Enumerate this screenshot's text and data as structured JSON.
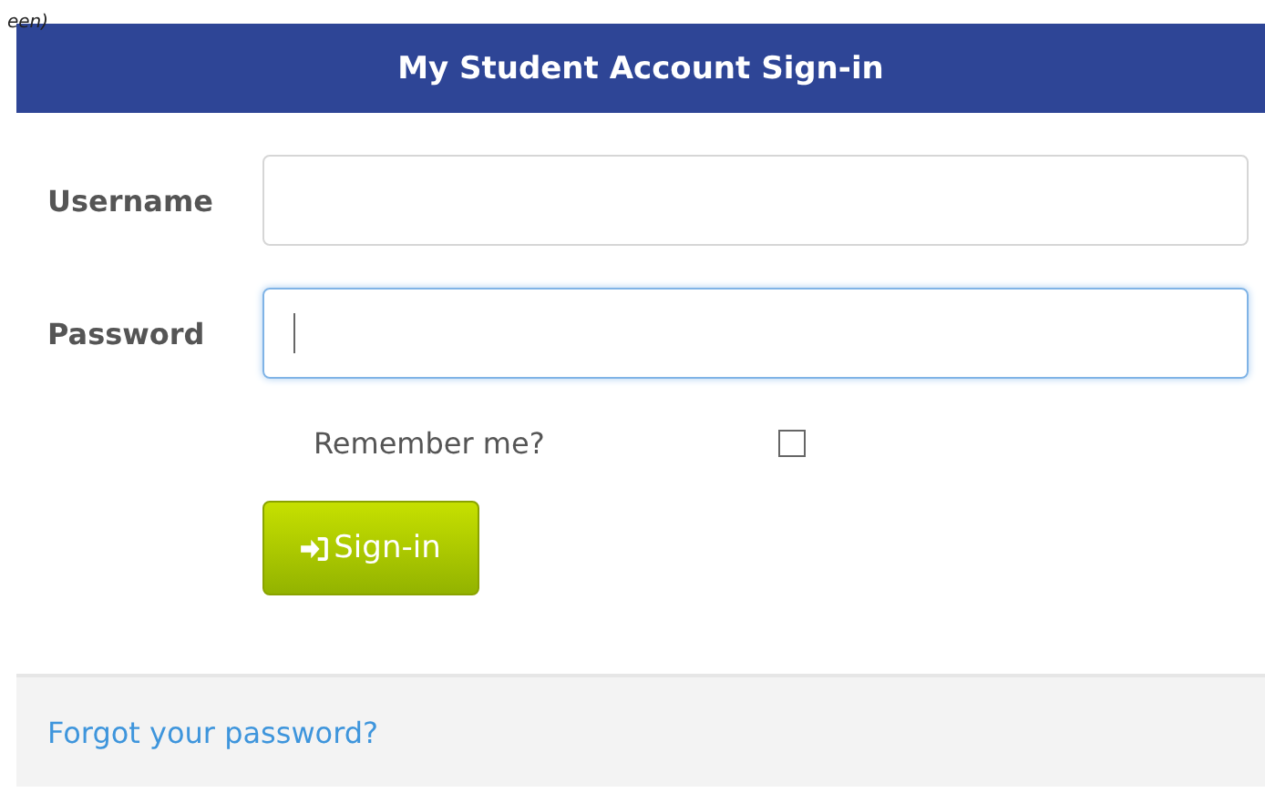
{
  "caption_fragment": "een)",
  "header": {
    "title": "My Student Account Sign-in"
  },
  "fields": [
    {
      "label": "Username",
      "focused": false
    },
    {
      "label": "Password",
      "focused": true
    }
  ],
  "remember": {
    "label": "Remember me?",
    "checked": false
  },
  "submit": {
    "label": "Sign-in"
  },
  "footer": {
    "link": "Forgot your password?"
  }
}
